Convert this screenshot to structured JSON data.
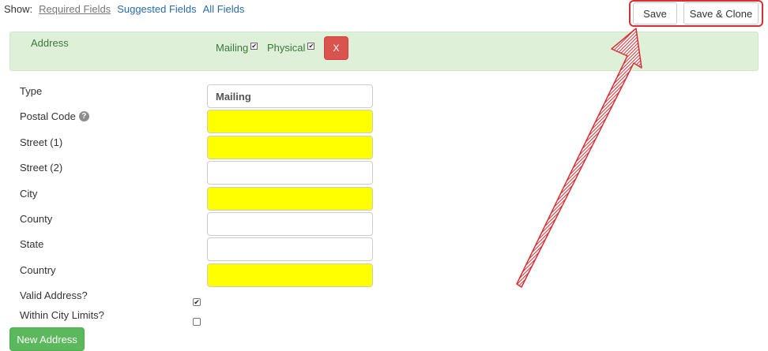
{
  "show_bar": {
    "label": "Show:",
    "links": [
      "Required Fields",
      "Suggested Fields",
      "All Fields"
    ],
    "active": "Required Fields"
  },
  "actions": {
    "save_label": "Save",
    "save_clone_label": "Save & Clone"
  },
  "address_panel": {
    "title": "Address",
    "mailing_label": "Mailing",
    "mailing_checked": true,
    "physical_label": "Physical",
    "physical_checked": true,
    "remove_label": "X"
  },
  "fields": [
    {
      "label": "Type",
      "value": "Mailing",
      "required": false
    },
    {
      "label": "Postal Code",
      "value": "",
      "required": true,
      "help": "?"
    },
    {
      "label": "Street (1)",
      "value": "",
      "required": true
    },
    {
      "label": "Street (2)",
      "value": "",
      "required": false
    },
    {
      "label": "City",
      "value": "",
      "required": true
    },
    {
      "label": "County",
      "value": "",
      "required": false
    },
    {
      "label": "State",
      "value": "",
      "required": false
    },
    {
      "label": "Country",
      "value": "",
      "required": true
    }
  ],
  "checkboxes": [
    {
      "label": "Valid Address?",
      "checked": true
    },
    {
      "label": "Within City Limits?",
      "checked": false
    }
  ],
  "new_address_label": "New Address",
  "colors": {
    "required_field": "#ffff00",
    "panel_bg": "#dff0d8",
    "remove_button": "#d9534f",
    "new_button": "#5cb85c",
    "annotation": "#d63035"
  }
}
